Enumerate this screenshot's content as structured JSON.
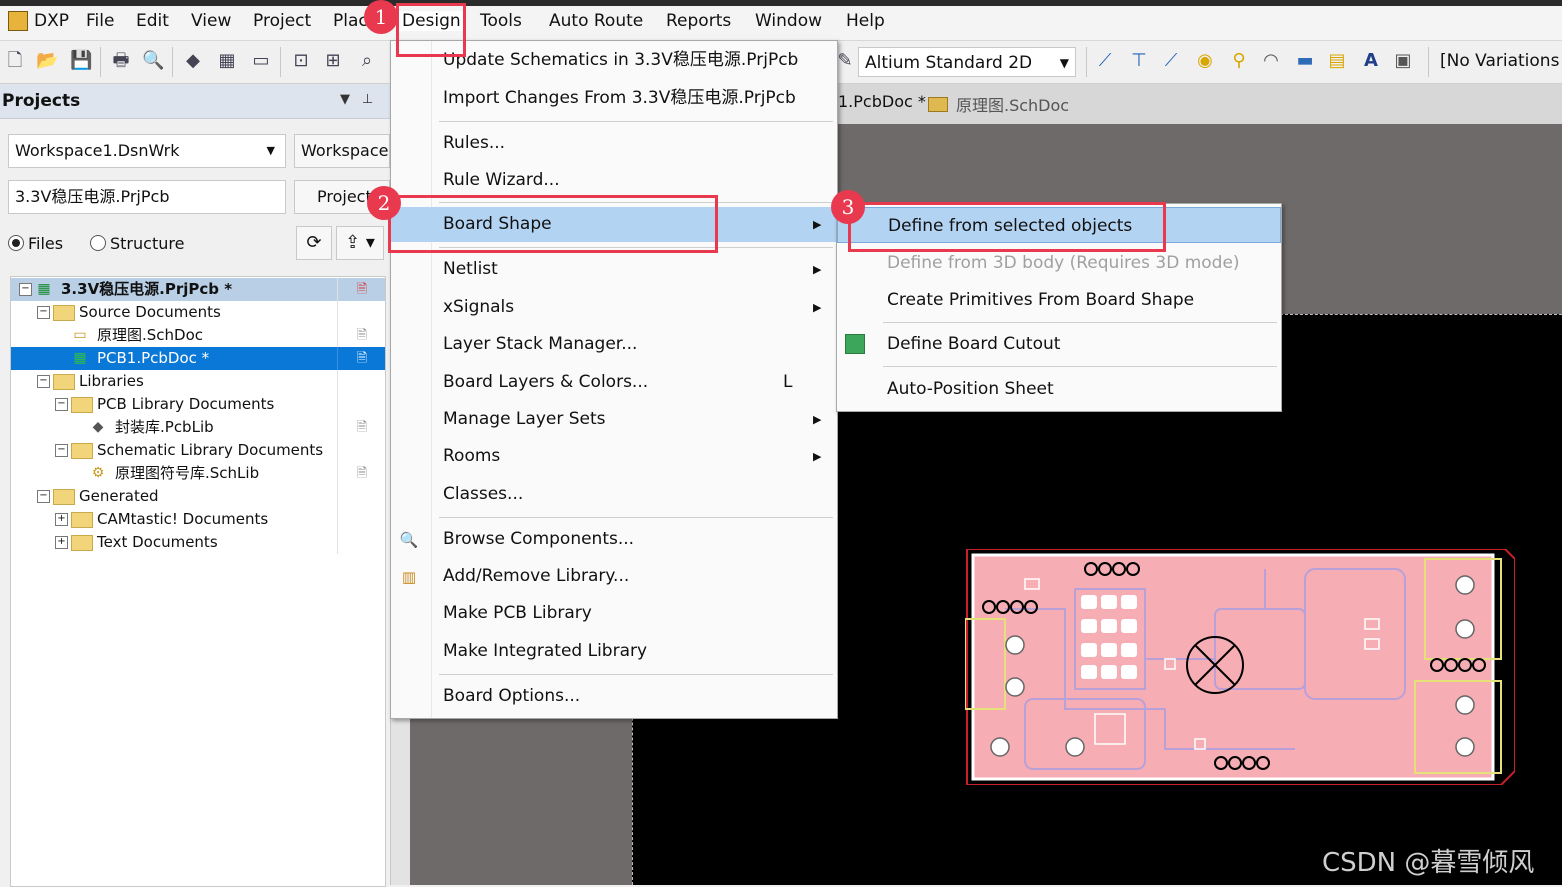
{
  "menubar": {
    "items": [
      "DXP",
      "File",
      "Edit",
      "View",
      "Project",
      "Plac",
      "Design",
      "Tools",
      "Auto Route",
      "Reports",
      "Window",
      "Help"
    ]
  },
  "toolbar": {
    "view_select": "Altium Standard 2D",
    "variations": "[No Variations"
  },
  "panel": {
    "title": "Projects",
    "workspace_combo": "Workspace1.DsnWrk",
    "workspace_button": "Workspace",
    "project_field": "3.3V稳压电源.PrjPcb",
    "project_button": "Project",
    "radio_files": "Files",
    "radio_structure": "Structure",
    "tree": [
      {
        "label": "3.3V稳压电源.PrjPcb *",
        "level": 0
      },
      {
        "label": "Source Documents",
        "level": 1
      },
      {
        "label": "原理图.SchDoc",
        "level": 2
      },
      {
        "label": "PCB1.PcbDoc *",
        "level": 2
      },
      {
        "label": "Libraries",
        "level": 1
      },
      {
        "label": "PCB Library Documents",
        "level": 2
      },
      {
        "label": "封装库.PcbLib",
        "level": 3
      },
      {
        "label": "Schematic Library Documents",
        "level": 2
      },
      {
        "label": "原理图符号库.SchLib",
        "level": 3
      },
      {
        "label": "Generated",
        "level": 1
      },
      {
        "label": "CAMtastic! Documents",
        "level": 2
      },
      {
        "label": "Text Documents",
        "level": 2
      }
    ]
  },
  "tabs": {
    "pcb": "1.PcbDoc *",
    "sch": "原理图.SchDoc"
  },
  "design_menu": {
    "items": [
      {
        "label": "Update Schematics in 3.3V稳压电源.PrjPcb"
      },
      {
        "label": "Import Changes From 3.3V稳压电源.PrjPcb"
      },
      {
        "label": "Rules..."
      },
      {
        "label": "Rule Wizard..."
      },
      {
        "label": "Board Shape"
      },
      {
        "label": "Netlist"
      },
      {
        "label": "xSignals"
      },
      {
        "label": "Layer Stack Manager..."
      },
      {
        "label": "Board Layers & Colors...",
        "shortcut": "L"
      },
      {
        "label": "Manage Layer Sets"
      },
      {
        "label": "Rooms"
      },
      {
        "label": "Classes..."
      },
      {
        "label": "Browse Components..."
      },
      {
        "label": "Add/Remove Library..."
      },
      {
        "label": "Make PCB Library"
      },
      {
        "label": "Make Integrated Library"
      },
      {
        "label": "Board Options..."
      }
    ]
  },
  "board_shape_menu": {
    "items": [
      {
        "label": "Define from selected objects"
      },
      {
        "label": "Define from 3D body (Requires 3D mode)"
      },
      {
        "label": "Create Primitives From Board Shape"
      },
      {
        "label": "Define Board Cutout"
      },
      {
        "label": "Auto-Position Sheet"
      }
    ]
  },
  "annotations": {
    "step1": "1",
    "step2": "2",
    "step3": "3",
    "accent_color": "#e8394f"
  },
  "watermark": "CSDN @暮雪倾风"
}
